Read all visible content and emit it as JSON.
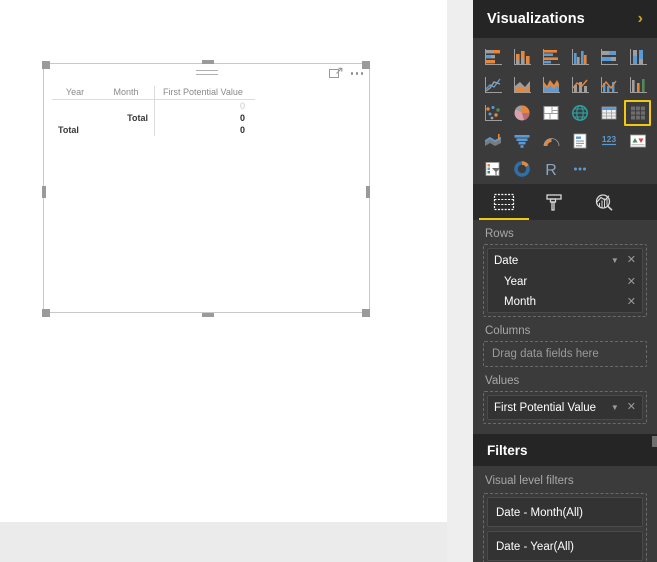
{
  "panel": {
    "title": "Visualizations",
    "expand_icon": "chevron-right-icon",
    "accent_color": "#f2c811",
    "background_color": "#3b3b3b"
  },
  "gallery": {
    "items": [
      {
        "icon": "stacked-bar-chart-icon"
      },
      {
        "icon": "stacked-column-chart-icon"
      },
      {
        "icon": "clustered-bar-chart-icon"
      },
      {
        "icon": "clustered-column-chart-icon"
      },
      {
        "icon": "hundred-percent-stacked-bar-chart-icon"
      },
      {
        "icon": "hundred-percent-stacked-column-chart-icon"
      },
      {
        "icon": "line-chart-icon"
      },
      {
        "icon": "area-chart-icon"
      },
      {
        "icon": "stacked-area-chart-icon"
      },
      {
        "icon": "line-and-stacked-column-chart-icon"
      },
      {
        "icon": "line-and-clustered-column-chart-icon"
      },
      {
        "icon": "ribbon-chart-icon"
      },
      {
        "icon": "scatter-chart-icon"
      },
      {
        "icon": "pie-chart-icon"
      },
      {
        "icon": "treemap-icon"
      },
      {
        "icon": "map-icon"
      },
      {
        "icon": "table-icon"
      },
      {
        "icon": "matrix-icon",
        "selected": true
      },
      {
        "icon": "filled-map-icon"
      },
      {
        "icon": "funnel-chart-icon"
      },
      {
        "icon": "gauge-chart-icon"
      },
      {
        "icon": "card-icon"
      },
      {
        "icon": "multi-row-card-icon"
      },
      {
        "icon": "kpi-icon"
      },
      {
        "icon": "slicer-icon"
      },
      {
        "icon": "donut-chart-icon"
      },
      {
        "icon": "r-script-visual-icon",
        "label": "R"
      },
      {
        "icon": "more-visuals-icon"
      }
    ]
  },
  "tabs": [
    {
      "name": "fields-tab",
      "icon": "fields-icon",
      "active": true
    },
    {
      "name": "format-tab",
      "icon": "paint-roller-icon",
      "active": false
    },
    {
      "name": "analytics-tab",
      "icon": "analytics-magnifier-icon",
      "active": false
    }
  ],
  "wells": {
    "rows": {
      "label": "Rows",
      "group_field": "Date",
      "children": [
        "Year",
        "Month"
      ]
    },
    "columns": {
      "label": "Columns",
      "placeholder": "Drag data fields here"
    },
    "values": {
      "label": "Values",
      "field": "First Potential Value"
    }
  },
  "filters": {
    "title": "Filters",
    "subtitle": "Visual level filters",
    "items": [
      "Date - Month(All)",
      "Date - Year(All)"
    ]
  },
  "visual": {
    "drag_handle_icon": "drag-handle-icon",
    "focus_icon": "focus-mode-icon",
    "more_icon": "more-options-icon",
    "matrix": {
      "headers": [
        "Year",
        "Month",
        "First Potential Value"
      ],
      "rows": [
        {
          "year": "",
          "month": "",
          "value": "0",
          "total": false
        },
        {
          "year": "",
          "month": "Total",
          "value": "0",
          "total": true
        },
        {
          "year": "Total",
          "month": "",
          "value": "0",
          "total": true
        }
      ]
    }
  }
}
